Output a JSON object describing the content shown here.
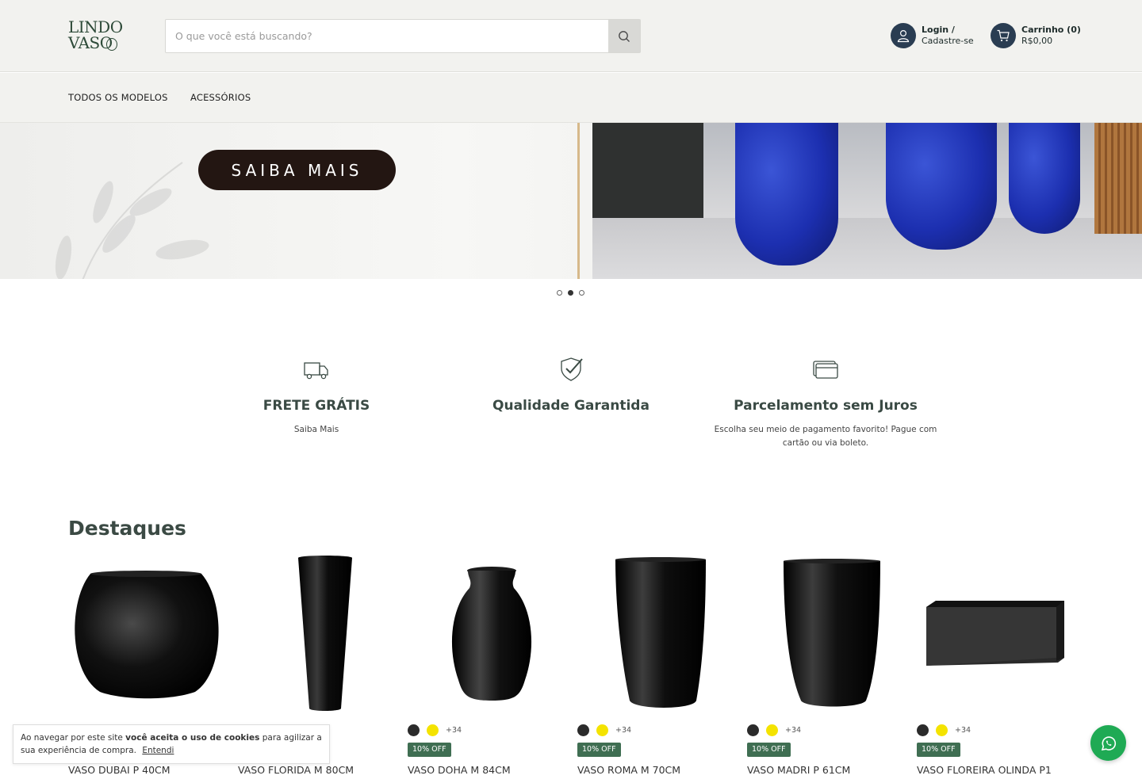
{
  "header": {
    "logo_line1": "LINDO",
    "logo_line2": "VASO",
    "search_placeholder": "O que você está buscando?",
    "login_line1": "Login /",
    "login_line2": "Cadastre-se",
    "cart_line1": "Carrinho (0)",
    "cart_line2": "R$0,00"
  },
  "nav": {
    "items": [
      "TODOS OS MODELOS",
      "ACESSÓRIOS"
    ]
  },
  "banner": {
    "button_label": "SAIBA MAIS",
    "active_slide": 2,
    "slide_count": 3
  },
  "features": [
    {
      "icon": "truck-icon",
      "title": "FRETE GRÁTIS",
      "desc": "Saiba Mais"
    },
    {
      "icon": "shield-check-icon",
      "title": "Qualidade Garantida",
      "desc": ""
    },
    {
      "icon": "cards-icon",
      "title": "Parcelamento sem Juros",
      "desc": "Escolha seu meio de pagamento favorito! Pague com cartão ou via boleto."
    }
  ],
  "section_title": "Destaques",
  "products": [
    {
      "name": "VASO DUBAI P 40CM",
      "more_colors": "",
      "badge": ""
    },
    {
      "name": "VASO FLORIDA M 80CM",
      "more_colors": "",
      "badge": ""
    },
    {
      "name": "VASO DOHA M 84CM",
      "more_colors": "+34",
      "badge": "10% OFF"
    },
    {
      "name": "VASO ROMA M 70CM",
      "more_colors": "+34",
      "badge": "10% OFF"
    },
    {
      "name": "VASO MADRI P 61CM",
      "more_colors": "+34",
      "badge": "10% OFF"
    },
    {
      "name": "VASO FLOREIRA OLINDA P1",
      "more_colors": "+34",
      "badge": "10% OFF"
    }
  ],
  "swatch_colors": [
    "#2b2b2b",
    "#f4e300"
  ],
  "cookie": {
    "text_before": "Ao navegar por este site ",
    "text_bold": "você aceita o uso de cookies",
    "text_after": " para agilizar a sua experiência de compra.",
    "button": "Entendi"
  },
  "colors": {
    "header_bg": "#f2f2ef",
    "brand_green": "#2d4a38",
    "badge_green": "#3f6e52",
    "icon_navy": "#2a3d52",
    "whatsapp_green": "#1faa54"
  }
}
